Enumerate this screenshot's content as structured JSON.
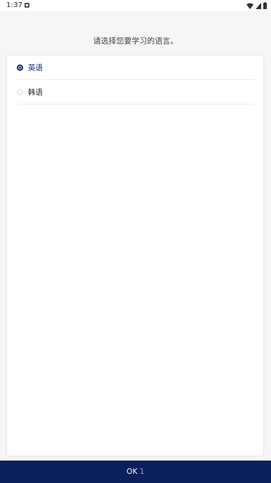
{
  "status_bar": {
    "time": "1:37",
    "icons": [
      "notification-icon",
      "wifi-icon",
      "signal-icon",
      "battery-icon"
    ]
  },
  "prompt": "请选择您要学习的语言。",
  "languages": [
    {
      "label": "英语",
      "selected": true
    },
    {
      "label": "韩语",
      "selected": false
    }
  ],
  "ok_button": {
    "label": "OK",
    "count": "1"
  },
  "colors": {
    "accent": "#0b1f5c",
    "count": "#7fa6e8",
    "background": "#f5f6f8"
  }
}
